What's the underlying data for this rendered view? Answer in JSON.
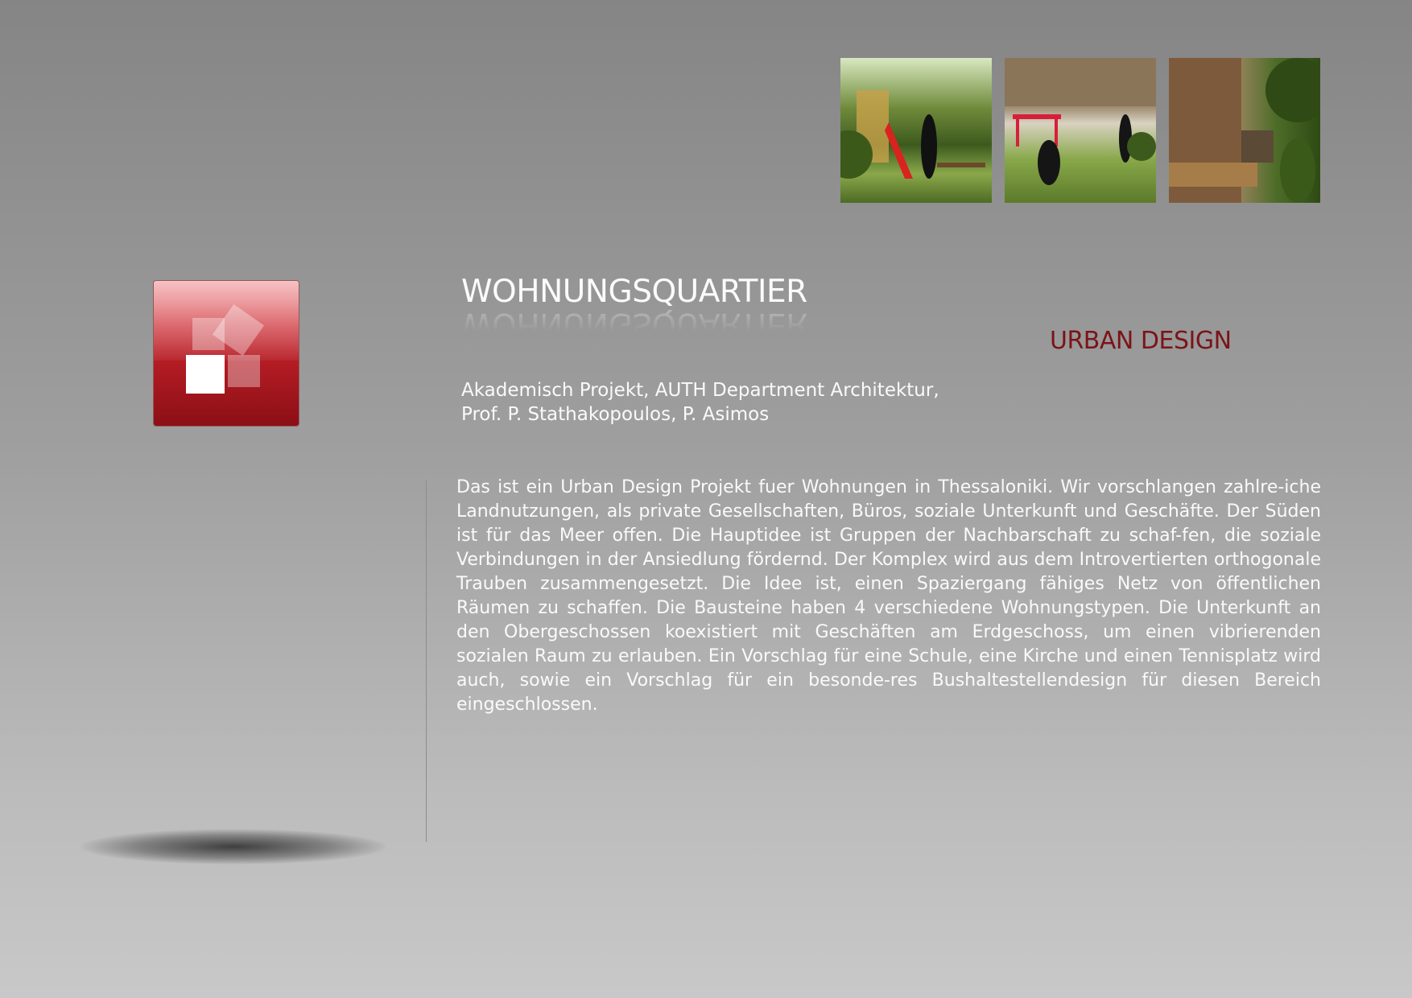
{
  "header": {
    "images": [
      {
        "name": "playground-render-1",
        "alt": "Playground render 1"
      },
      {
        "name": "playground-render-2",
        "alt": "Playground render 2"
      },
      {
        "name": "playground-render-3",
        "alt": "Playground render 3"
      }
    ]
  },
  "project": {
    "title": "WOHNUNGSQUARTIER",
    "category": "URBAN DESIGN",
    "credits": [
      "Akademisch Projekt, AUTH Department Architektur,",
      "Prof. P. Stathakopoulos, P. Asimos"
    ],
    "description": "Das ist ein Urban Design Projekt fuer Wohnungen in Thessaloniki. Wir vorschlangen zahlre-iche Landnutzungen, als private Gesellschaften, Büros, soziale Unterkunft und Geschäfte. Der Süden ist für das Meer offen. Die Hauptidee ist Gruppen der Nachbarschaft zu schaf-fen, die soziale Verbindungen in der Ansiedlung fördernd. Der Komplex wird aus dem Introvertierten orthogonale Trauben zusammengesetzt. Die Idee ist, einen Spaziergang fähiges Netz von öffentlichen Räumen zu schaffen. Die Bausteine haben 4 verschiedene Wohnungstypen. Die Unterkunft an den Obergeschossen koexistiert mit Geschäften am Erdgeschoss, um einen vibrierenden sozialen Raum zu erlauben. Ein Vorschlag für eine Schule, eine Kirche und einen Tennisplatz wird auch, sowie ein Vorschlag für ein besonde-res Bushaltestellendesign für diesen Bereich eingeschlossen."
  },
  "logo": {
    "icon": "overlapping-squares-icon"
  },
  "colors": {
    "accent": "#7a1418",
    "logo_red": "#b51c24",
    "text": "#fafafa"
  }
}
